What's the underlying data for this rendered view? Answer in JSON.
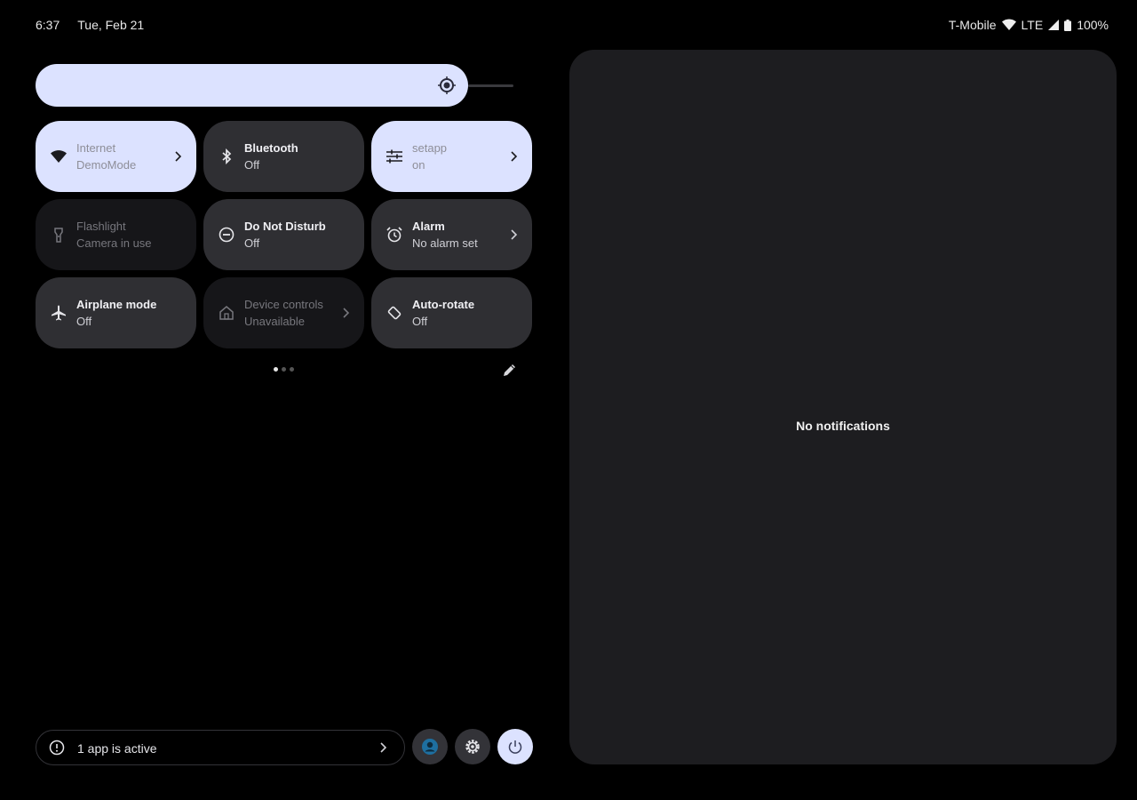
{
  "status_bar": {
    "time": "6:37",
    "date": "Tue, Feb 21",
    "carrier": "T-Mobile",
    "network": "LTE",
    "battery": "100%"
  },
  "brightness": {
    "level": 0.906
  },
  "tiles": [
    {
      "label": "Internet",
      "sub": "DemoMode",
      "icon": "wifi-icon",
      "state": "on",
      "chevron": true
    },
    {
      "label": "Bluetooth",
      "sub": "Off",
      "icon": "bluetooth-icon",
      "state": "off",
      "chevron": false
    },
    {
      "label": "setapp",
      "sub": "on",
      "icon": "sliders-icon",
      "state": "on",
      "chevron": true
    },
    {
      "label": "Flashlight",
      "sub": "Camera in use",
      "icon": "flashlight-icon",
      "state": "unavailable",
      "chevron": false
    },
    {
      "label": "Do Not Disturb",
      "sub": "Off",
      "icon": "do-not-disturb-icon",
      "state": "off",
      "chevron": false
    },
    {
      "label": "Alarm",
      "sub": "No alarm set",
      "icon": "alarm-icon",
      "state": "off",
      "chevron": true
    },
    {
      "label": "Airplane mode",
      "sub": "Off",
      "icon": "airplane-icon",
      "state": "off",
      "chevron": false
    },
    {
      "label": "Device controls",
      "sub": "Unavailable",
      "icon": "home-icon",
      "state": "unavailable",
      "chevron": true
    },
    {
      "label": "Auto-rotate",
      "sub": "Off",
      "icon": "rotate-icon",
      "state": "off",
      "chevron": false
    }
  ],
  "pager": {
    "pages": 3,
    "current": 1
  },
  "footer": {
    "active_apps_label": "1 app is active"
  },
  "notifications": {
    "empty_text": "No notifications"
  },
  "colors": {
    "tile_on": "#dce2ff",
    "tile_off": "#2f2f33",
    "panel": "#1d1d20"
  }
}
